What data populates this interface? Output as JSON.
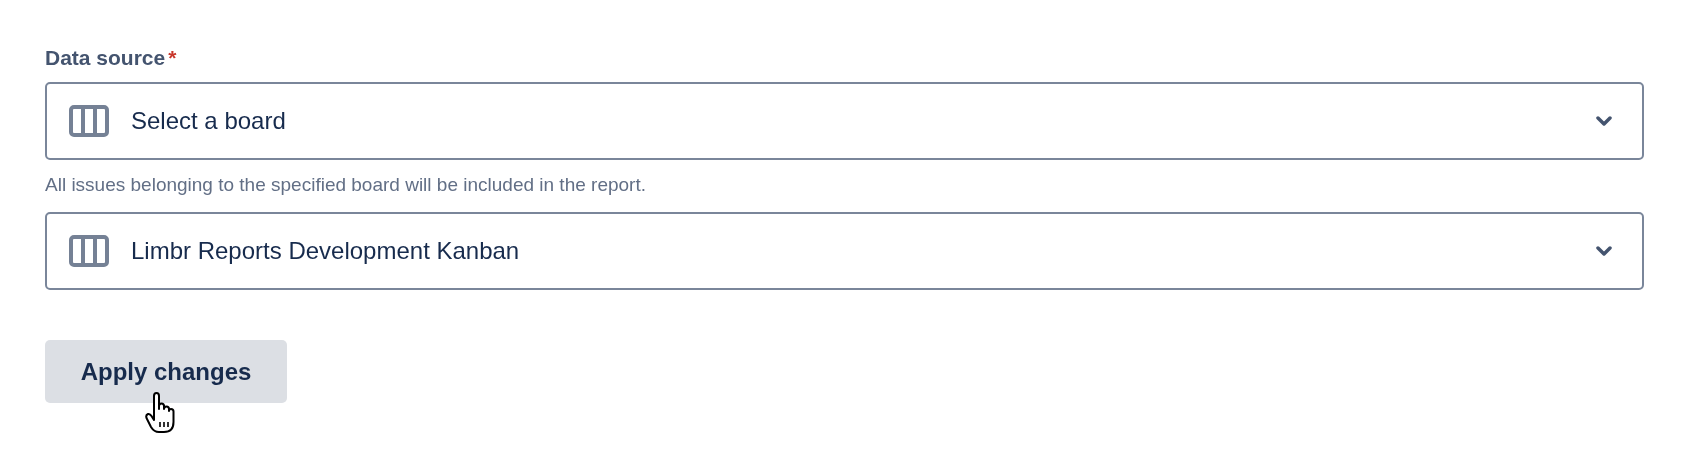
{
  "field": {
    "label": "Data source",
    "required_mark": "*",
    "selects": [
      {
        "placeholder": "Select a board"
      },
      {
        "value": "Limbr Reports Development Kanban"
      }
    ],
    "helper": "All issues belonging to the specified board will be included in the report."
  },
  "button": {
    "label": "Apply changes",
    "hovered": true
  }
}
